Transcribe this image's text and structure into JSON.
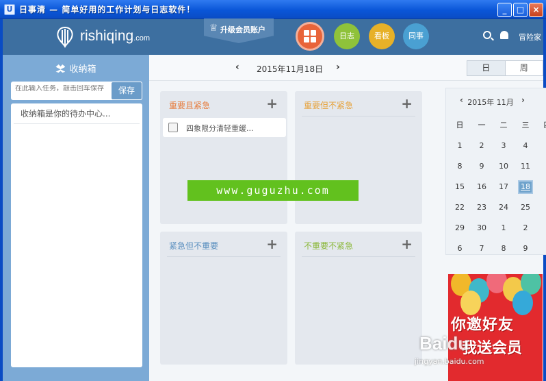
{
  "window": {
    "icon_label": "U",
    "title": "日事清 — 简单好用的工作计划与日志软件！",
    "buttons": [
      "_",
      "□",
      "×"
    ]
  },
  "header": {
    "logo_text": "rishiqing",
    "logo_suffix": ".com",
    "upgrade_label": "升级会员账户",
    "nav": {
      "log": "日志",
      "board": "看板",
      "colleague": "同事"
    },
    "user_label": "冒险家"
  },
  "sidebar": {
    "title": "收纳箱",
    "input_placeholder": "在此输入任务，敲击回车保存",
    "save_label": "保存",
    "items": [
      "收纳箱是你的待办中心..."
    ]
  },
  "datebar": {
    "prev": "‹",
    "next": "›",
    "current_date": "2015年11月18日",
    "views": {
      "day": "日",
      "week": "周"
    }
  },
  "quadrants": {
    "q1": {
      "title": "重要且紧急",
      "tasks": [
        "四象限分清轻重缓..."
      ]
    },
    "q2": {
      "title": "重要但不紧急"
    },
    "q3": {
      "title": "紧急但不重要"
    },
    "q4": {
      "title": "不重要不紧急"
    },
    "add_symbol": "+"
  },
  "watermark": "www.guguzhu.com",
  "calendar": {
    "month_label": "2015年 11月",
    "weekdays": [
      "日",
      "一",
      "二",
      "三",
      "四"
    ],
    "days": [
      [
        "1",
        "2",
        "3",
        "4"
      ],
      [
        "8",
        "9",
        "10",
        "11"
      ],
      [
        "15",
        "16",
        "17",
        "18"
      ],
      [
        "22",
        "23",
        "24",
        "25"
      ],
      [
        "29",
        "30",
        "1",
        "2"
      ],
      [
        "6",
        "7",
        "8",
        "9"
      ]
    ],
    "selected": "18"
  },
  "promo": {
    "line1": "你邀好友",
    "line2": "我送会员"
  },
  "overlay": {
    "brand": "Baidu",
    "url": "jingyan.baidu.com"
  },
  "colors": {
    "header": "#3d6fa0",
    "sidebar": "#7caad6",
    "accent_orange": "#e8643a",
    "green": "#8fc23a",
    "yellow": "#e7b128",
    "blue": "#4aa0d2"
  }
}
